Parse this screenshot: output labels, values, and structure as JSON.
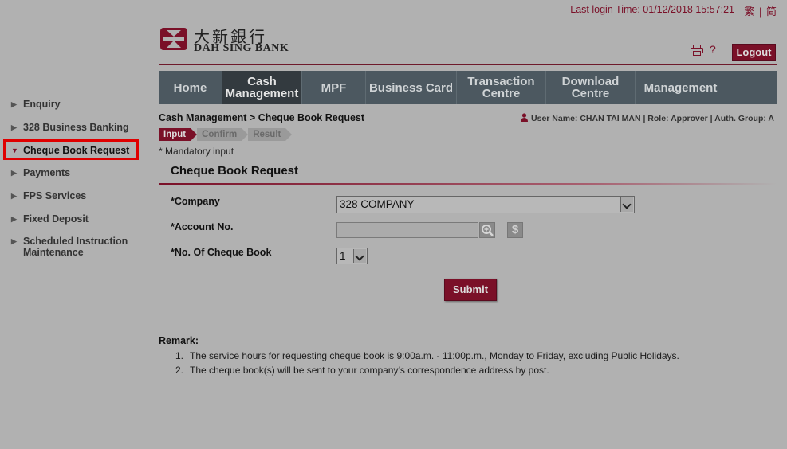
{
  "header": {
    "last_login": "Last login Time: 01/12/2018 15:57:21",
    "lang_trad": "繁",
    "lang_sep": "|",
    "lang_simp": "简",
    "logo_cn": "大新銀行",
    "logo_en": "DAH SING BANK",
    "help": "?",
    "logout": "Logout"
  },
  "nav": [
    {
      "label": "Home",
      "active": false
    },
    {
      "label": "Cash Management",
      "active": true
    },
    {
      "label": "MPF",
      "active": false
    },
    {
      "label": "Business Card",
      "active": false
    },
    {
      "label": "Transaction Centre",
      "active": false
    },
    {
      "label": "Download Centre",
      "active": false
    },
    {
      "label": "Management",
      "active": false
    }
  ],
  "sidebar": {
    "items": [
      {
        "label": "Enquiry",
        "arrow": "▶"
      },
      {
        "label": "328 Business Banking",
        "arrow": "▶"
      },
      {
        "label": "Cheque Book Request",
        "arrow": "▼"
      },
      {
        "label": "Payments",
        "arrow": "▶"
      },
      {
        "label": "FPS Services",
        "arrow": "▶"
      },
      {
        "label": "Fixed Deposit",
        "arrow": "▶"
      },
      {
        "label": "Scheduled Instruction",
        "label2": "Maintenance",
        "arrow": "▶"
      }
    ]
  },
  "breadcrumb": "Cash Management > Cheque Book Request",
  "user_info": "User Name: CHAN TAI MAN | Role: Approver | Auth. Group: A",
  "steps": [
    "Input",
    "Confirm",
    "Result"
  ],
  "mandatory": "* Mandatory input",
  "form": {
    "title": "Cheque Book Request",
    "company_label": "*Company",
    "company_value": "328 COMPANY",
    "account_label": "*Account No.",
    "account_value": "",
    "cheque_label": "*No. Of Cheque Book",
    "cheque_value": "1",
    "search_icon": "magnifier-plus-icon",
    "dollar_icon": "dollar-icon",
    "submit": "Submit"
  },
  "remarks": {
    "title": "Remark:",
    "items": [
      {
        "n": "1.",
        "text": "The service hours for requesting cheque book is 9:00a.m. - 11:00p.m., Monday to Friday, excluding Public Holidays."
      },
      {
        "n": "2.",
        "text": "The cheque book(s) will be sent to your company’s correspondence address by post."
      }
    ]
  },
  "colors": {
    "brand": "#7a1028",
    "nav": "#4c5860",
    "highlight": "#e00000"
  }
}
